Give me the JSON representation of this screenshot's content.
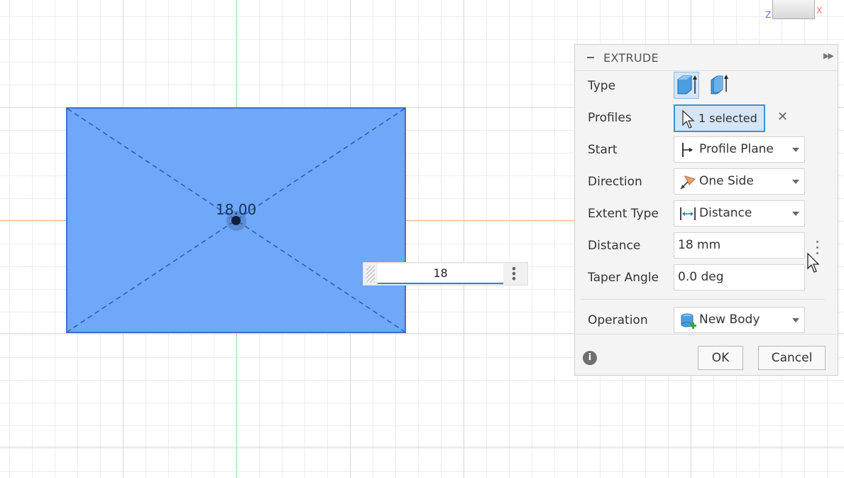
{
  "viewport": {
    "viewcube_axes": {
      "z": "Z",
      "x": "X"
    },
    "sketch": {
      "dimension_label": "18.00"
    },
    "mini_input": {
      "value": "18"
    }
  },
  "panel": {
    "title": "EXTRUDE",
    "rows": {
      "type": {
        "label": "Type",
        "options": [
          "one-side-extrude-icon",
          "two-side-extrude-icon"
        ],
        "selected": "one-side-extrude-icon"
      },
      "profiles": {
        "label": "Profiles",
        "value": "1 selected"
      },
      "start": {
        "label": "Start",
        "value": "Profile Plane",
        "icon": "profile-plane-icon"
      },
      "direction": {
        "label": "Direction",
        "value": "One Side",
        "icon": "one-side-direction-icon"
      },
      "extent_type": {
        "label": "Extent Type",
        "value": "Distance",
        "icon": "distance-extent-icon"
      },
      "distance": {
        "label": "Distance",
        "value": "18 mm"
      },
      "taper_angle": {
        "label": "Taper Angle",
        "value": "0.0 deg"
      },
      "operation": {
        "label": "Operation",
        "value": "New Body",
        "icon": "new-body-icon"
      }
    },
    "buttons": {
      "ok": "OK",
      "cancel": "Cancel"
    }
  },
  "colors": {
    "sketch_fill": "#6ea8f7",
    "sketch_border": "#3d72c4",
    "active_blue": "#3f93cf",
    "x_axis": "#f1b39a",
    "y_axis": "#9ed89e"
  }
}
